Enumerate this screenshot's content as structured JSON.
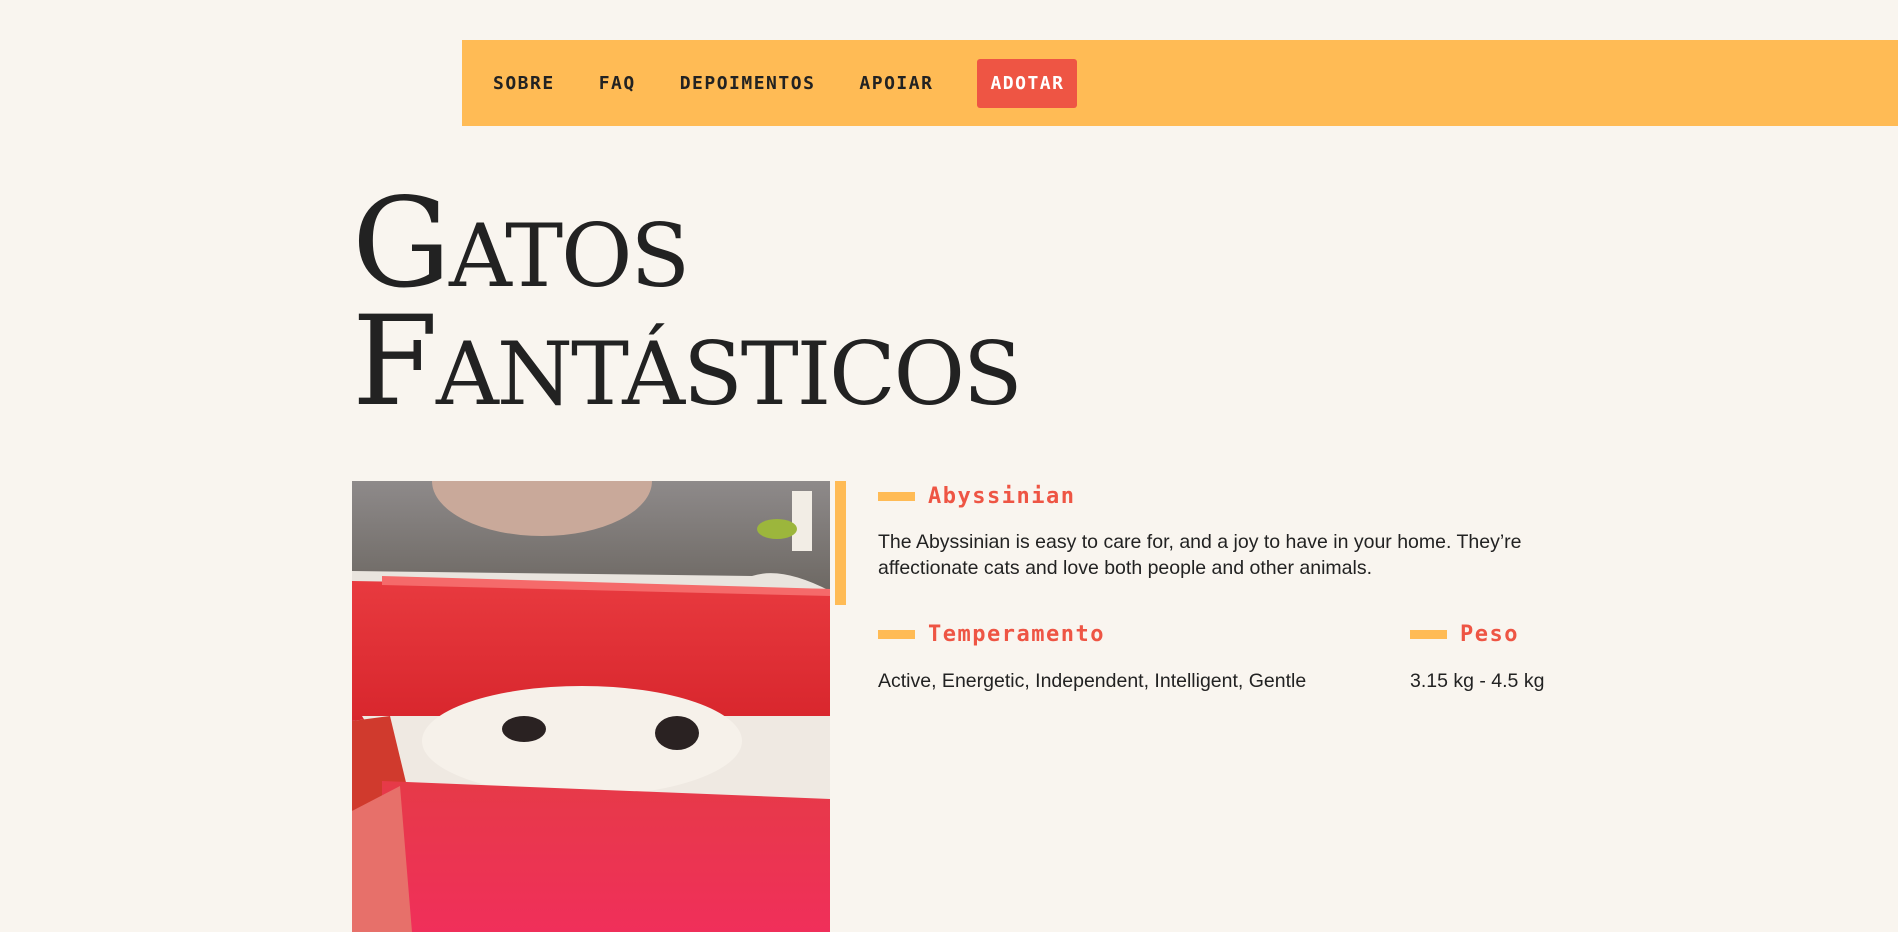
{
  "nav": {
    "items": [
      "SOBRE",
      "FAQ",
      "DEPOIMENTOS",
      "APOIAR"
    ],
    "cta": "ADOTAR"
  },
  "hero": {
    "title_line1": "Gatos",
    "title_line2": "Fantásticos"
  },
  "breed": {
    "name": "Abyssinian",
    "description": "The Abyssinian is easy to care for, and a joy to have in your home. They’re affectionate cats and love both people and other animals.",
    "temperament_label": "Temperamento",
    "temperament": "Active, Energetic, Independent, Intelligent, Gentle",
    "weight_label": "Peso",
    "weight": "3.15 kg - 4.5 kg"
  },
  "colors": {
    "background": "#f9f5ef",
    "accent": "#ffbb55",
    "primary": "#ee5544",
    "text": "#222222"
  }
}
